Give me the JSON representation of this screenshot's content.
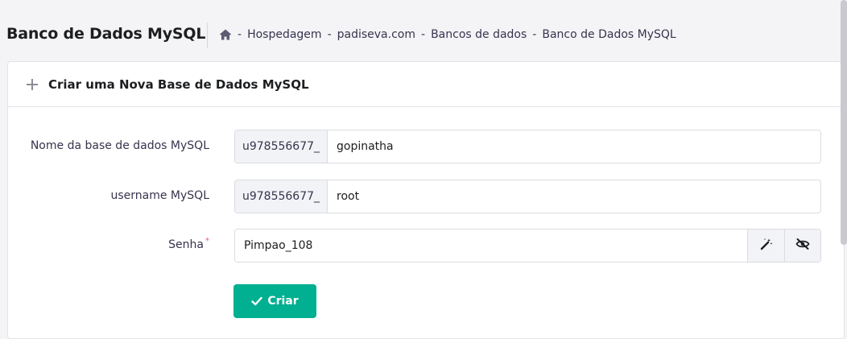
{
  "header": {
    "title": "Banco de Dados MySQL",
    "breadcrumb": {
      "home_icon": "home-icon",
      "separator": "-",
      "items": [
        "Hospedagem",
        "padiseva.com",
        "Bancos de dados",
        "Banco de Dados MySQL"
      ]
    }
  },
  "card": {
    "title": "Criar uma Nova Base de Dados MySQL",
    "icon": "plus-icon"
  },
  "form": {
    "database": {
      "label": "Nome da base de dados MySQL",
      "prefix": "u978556677_",
      "value": "gopinatha"
    },
    "username": {
      "label": "username MySQL",
      "prefix": "u978556677_",
      "value": "root"
    },
    "password": {
      "label": "Senha",
      "required_mark": "*",
      "value": "Pimpao_108",
      "generate_icon": "magic-wand-icon",
      "toggle_icon": "eye-slash-icon"
    },
    "submit_label": "Criar",
    "submit_icon": "check-icon"
  },
  "colors": {
    "accent": "#00b090",
    "required": "#fc5185",
    "title": "#1d1e20",
    "text": "#36344d"
  }
}
